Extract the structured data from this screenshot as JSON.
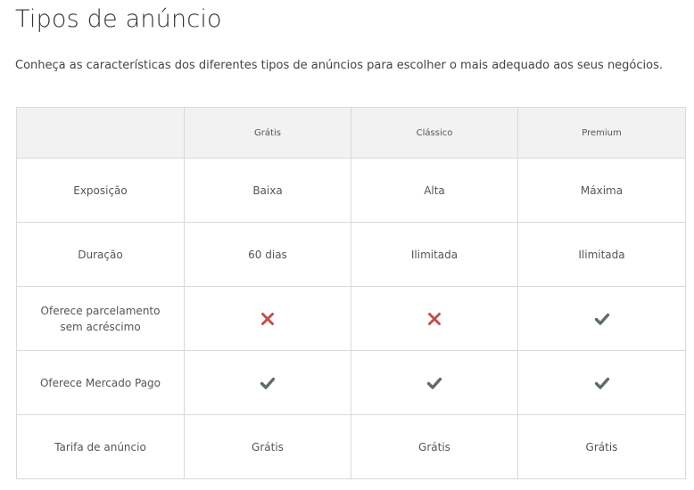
{
  "title": "Tipos de anúncio",
  "subtitle": "Conheça as características dos diferentes tipos de anúncios para escolher o mais adequado aos seus negócios.",
  "colors": {
    "check": "#5d6e64",
    "cross": "#c0504d"
  },
  "table": {
    "columns": [
      "",
      "Grátis",
      "Clássico",
      "Premium"
    ],
    "rows": [
      {
        "label": "Exposição",
        "cells": [
          "Baixa",
          "Alta",
          "Máxima"
        ]
      },
      {
        "label": "Duração",
        "cells": [
          "60 dias",
          "Ilimitada",
          "Ilimitada"
        ]
      },
      {
        "label": "Oferece parcelamento sem acréscimo",
        "cells": [
          "cross-icon",
          "cross-icon",
          "check-icon"
        ]
      },
      {
        "label": "Oferece Mercado Pago",
        "cells": [
          "check-icon",
          "check-icon",
          "check-icon"
        ]
      },
      {
        "label": "Tarifa de anúncio",
        "cells": [
          "Grátis",
          "Grátis",
          "Grátis"
        ]
      }
    ]
  }
}
